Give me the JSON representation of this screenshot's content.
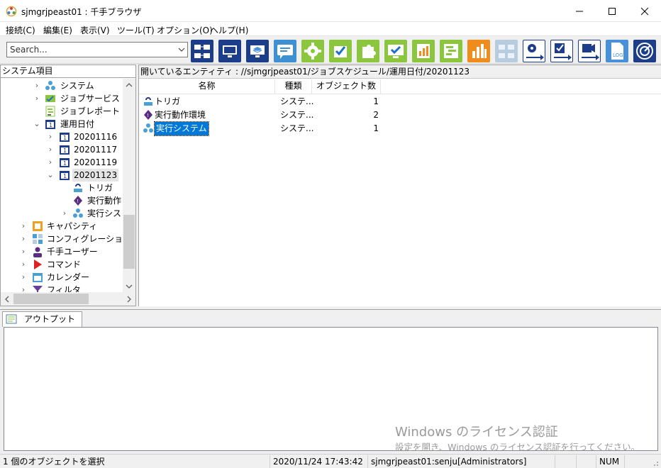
{
  "window": {
    "title": "sjmgrjpeast01 : 千手ブラウザ",
    "controls": [
      "minimize",
      "maximize",
      "close"
    ]
  },
  "menu": [
    "接続(C)",
    "編集(E)",
    "表示(V)",
    "ツール(T)",
    "オプション(O)",
    "ヘルプ(H)"
  ],
  "search": {
    "placeholder": "Search...",
    "value": ""
  },
  "toolbar": {
    "icons": [
      "network-icon",
      "monitor-icon",
      "layers-monitor-icon",
      "chat-icon",
      "green-gear-icon",
      "green-check-puzzle-icon",
      "green-puzzle-icon",
      "green-monitor-check-icon",
      "chart-report-icon",
      "gantt-icon",
      "orange-chart-icon",
      "gray-network-icon",
      "gear-arrow-icon",
      "check-arrow-icon",
      "camera-arrow-icon",
      "log-icon",
      "radar-icon"
    ]
  },
  "left_pane": {
    "header": "システム項目",
    "tree": [
      {
        "label": "システム",
        "icon": "system-icon",
        "expander": "collapsed"
      },
      {
        "label": "ジョブサービス",
        "icon": "job-service-icon",
        "expander": "collapsed"
      },
      {
        "label": "ジョブレポート",
        "icon": "job-report-icon",
        "expander": "none"
      },
      {
        "label": "運用日付",
        "icon": "calendar-date-icon",
        "expander": "expanded"
      },
      {
        "label": "20201116",
        "icon": "calendar-date-icon",
        "expander": "collapsed"
      },
      {
        "label": "20201117",
        "icon": "calendar-date-icon",
        "expander": "collapsed"
      },
      {
        "label": "20201119",
        "icon": "calendar-date-icon",
        "expander": "collapsed"
      },
      {
        "label": "20201123",
        "icon": "calendar-date-icon",
        "expander": "expanded",
        "selected": true
      },
      {
        "label": "トリガ",
        "icon": "trigger-icon",
        "expander": "none"
      },
      {
        "label": "実行動作",
        "icon": "exec-env-icon",
        "expander": "none"
      },
      {
        "label": "実行シス",
        "icon": "system-icon",
        "expander": "collapsed"
      },
      {
        "label": "キャパシティ",
        "icon": "capacity-icon",
        "expander": "collapsed"
      },
      {
        "label": "コンフィグレーション",
        "icon": "config-icon",
        "expander": "collapsed"
      },
      {
        "label": "千手ユーザー",
        "icon": "user-icon",
        "expander": "collapsed"
      },
      {
        "label": "コマンド",
        "icon": "command-icon",
        "expander": "collapsed"
      },
      {
        "label": "カレンダー",
        "icon": "calendar-icon",
        "expander": "collapsed"
      },
      {
        "label": "フィルタ",
        "icon": "filter-icon",
        "expander": "collapsed"
      }
    ]
  },
  "right_pane": {
    "path": "開いているエンティティ : //sjmgrjpeast01/ジョブスケジュール/運用日付/20201123",
    "columns": [
      "名称",
      "種類",
      "オブジェクト数"
    ],
    "rows": [
      {
        "name": "トリガ",
        "type": "システ...",
        "count": "1",
        "icon": "trigger-icon"
      },
      {
        "name": "実行動作環境",
        "type": "システ...",
        "count": "2",
        "icon": "exec-env-icon"
      },
      {
        "name": "実行システム",
        "type": "システ...",
        "count": "1",
        "icon": "system-icon",
        "selected": true
      }
    ]
  },
  "output": {
    "tab_label": "アウトプットビュー"
  },
  "watermark": {
    "line1": "Windows のライセンス認証",
    "line2": "設定を開き、Windows のライセンス認証を行ってください。"
  },
  "status": {
    "message": "1 個のオブジェクトを選択",
    "datetime": "2020/11/24 17:43:42",
    "user": "sjmgrjpeast01:senju[Administrators]",
    "num": "NUM"
  }
}
